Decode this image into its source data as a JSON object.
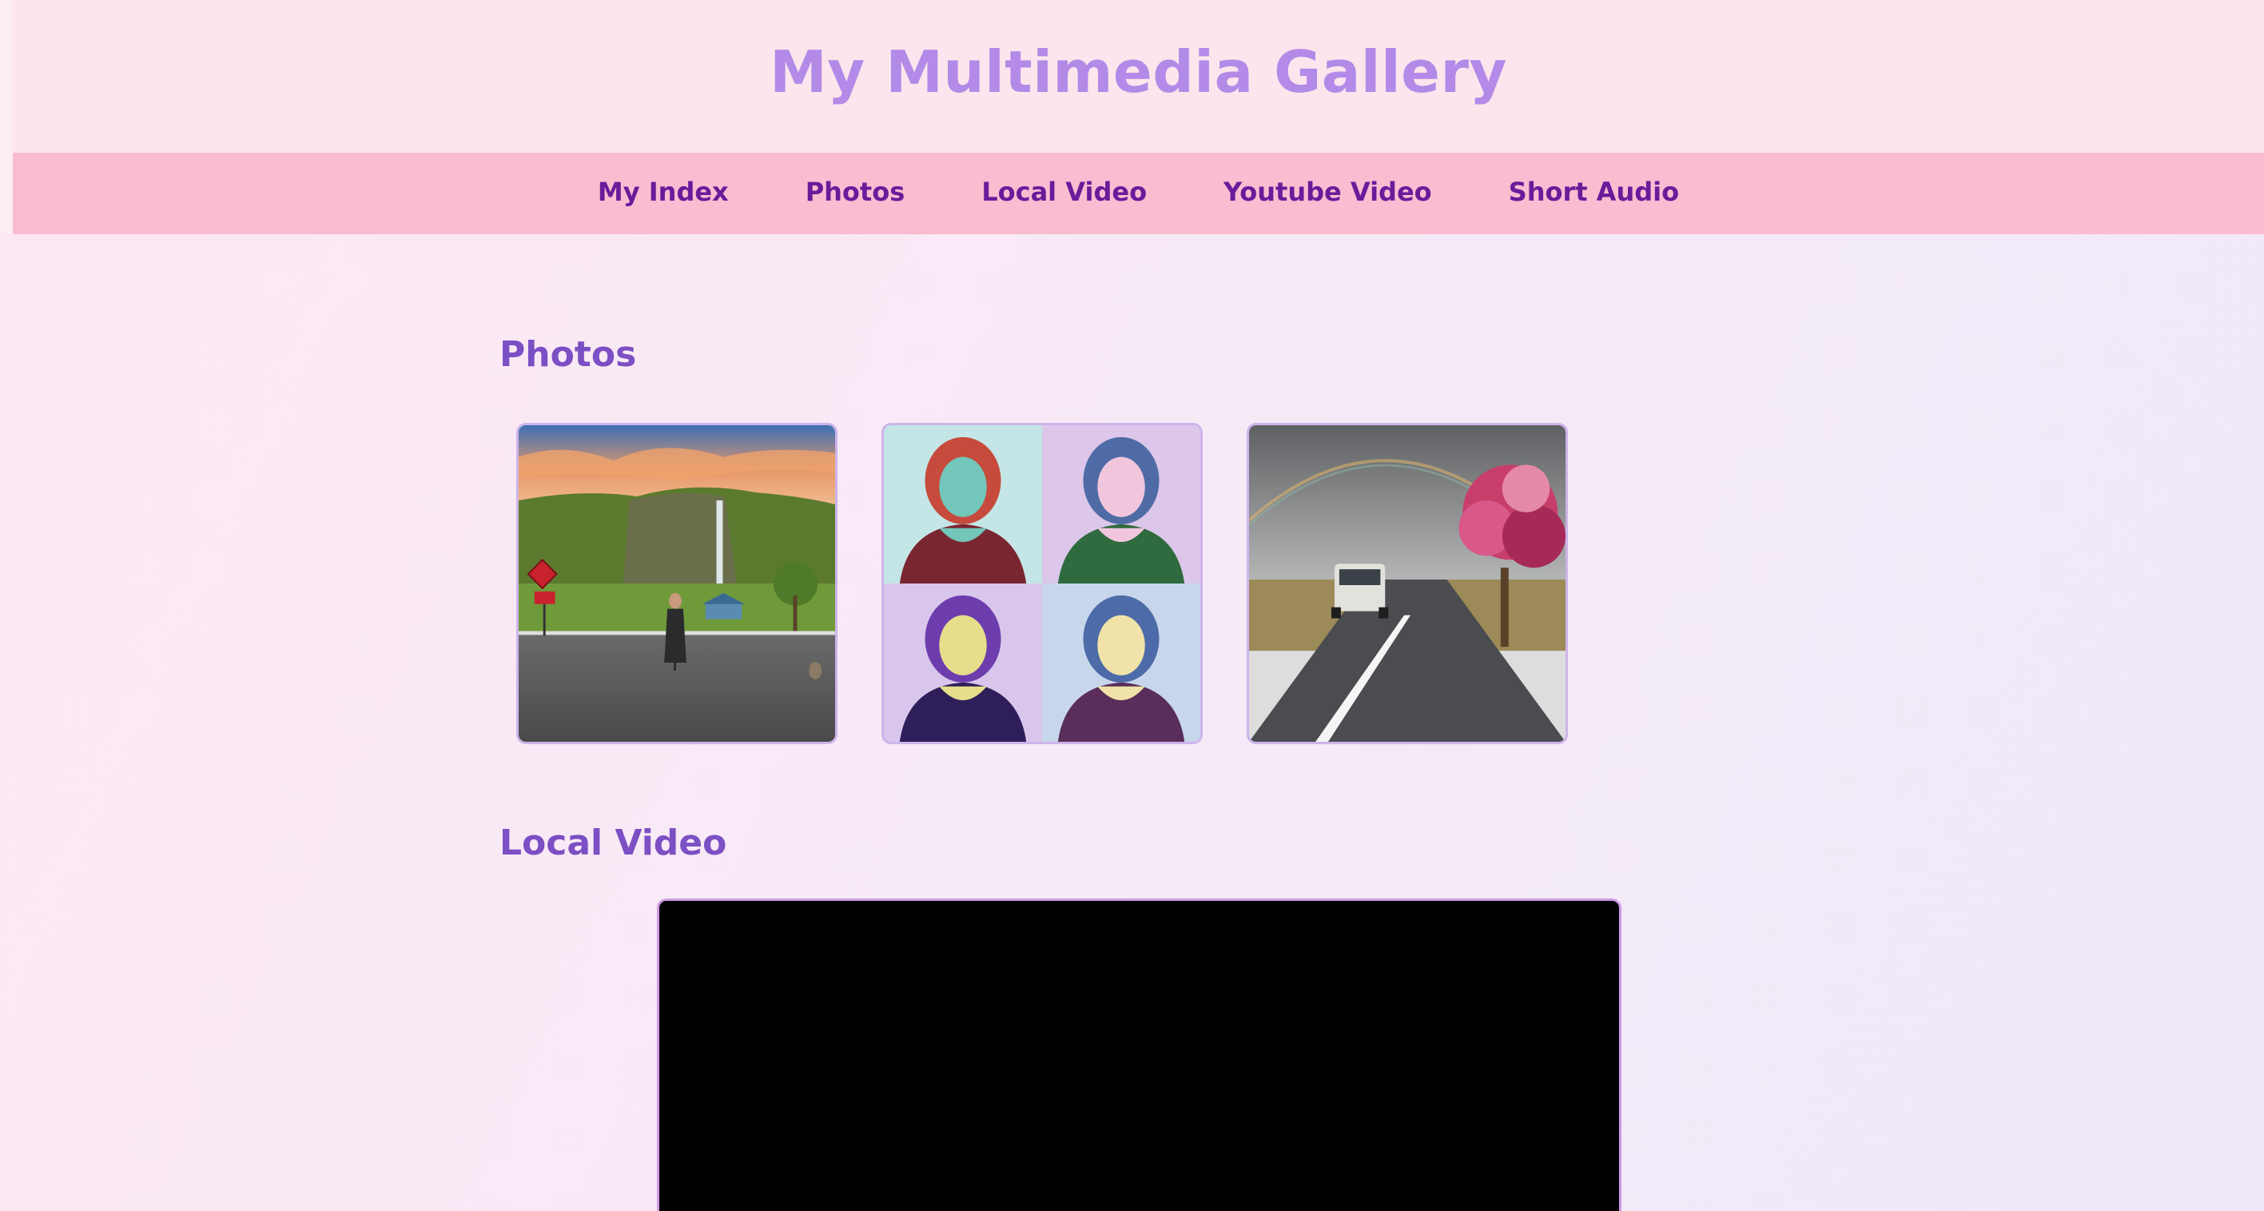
{
  "header": {
    "title": "My Multimedia Gallery"
  },
  "nav": {
    "items": [
      {
        "label": "My Index"
      },
      {
        "label": "Photos"
      },
      {
        "label": "Local Video"
      },
      {
        "label": "Youtube Video"
      },
      {
        "label": "Short Audio"
      }
    ]
  },
  "sections": {
    "photos": {
      "heading": "Photos",
      "images": [
        {
          "subject": "landscape-waterfall-woman-road"
        },
        {
          "subject": "pop-art-portrait-grid"
        },
        {
          "subject": "road-van-rainbow-tree"
        }
      ]
    },
    "local_video": {
      "heading": "Local Video"
    }
  },
  "colors": {
    "title": "#b38ae8",
    "header_bg": "#fce5ec",
    "nav_bg": "#f9bcd1",
    "nav_text": "#6a1b9a",
    "section_heading": "#7c4fc4",
    "photo_border": "#cdb4ea",
    "video_bg": "#000000"
  }
}
